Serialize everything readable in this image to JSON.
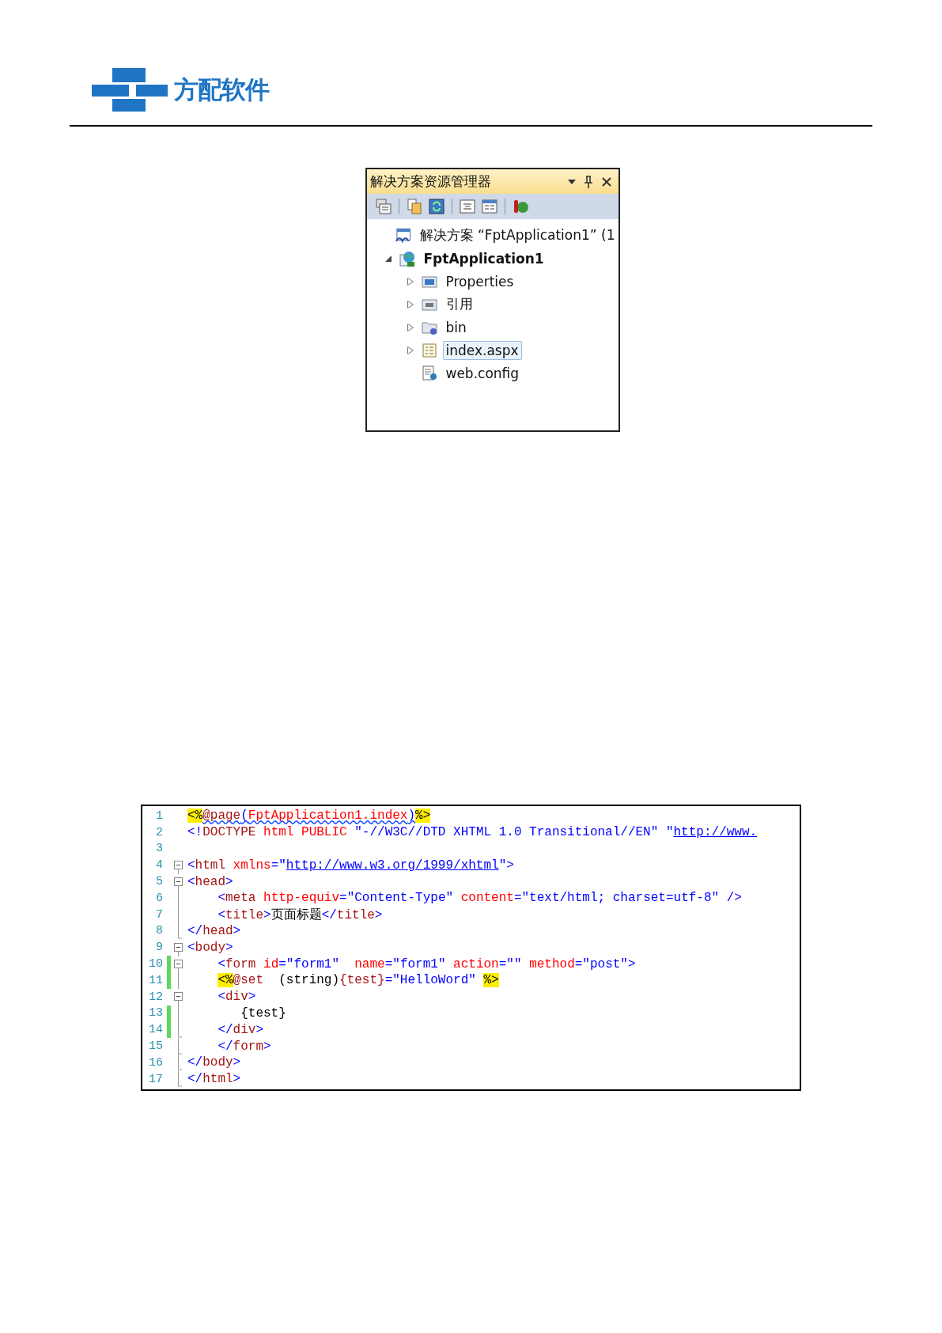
{
  "header": {
    "logo_text": "方配软件"
  },
  "solution_explorer": {
    "title": "解决方案资源管理器",
    "tree": [
      {
        "label": "解决方案 “FptApplication1” (1",
        "kind": "solution",
        "selected": false,
        "children": [
          {
            "label": "FptApplication1",
            "kind": "project",
            "expanded": true,
            "selected": false,
            "children": [
              {
                "label": "Properties",
                "kind": "properties",
                "expanded": false,
                "selected": false
              },
              {
                "label": "引用",
                "kind": "references",
                "expanded": false,
                "selected": false
              },
              {
                "label": "bin",
                "kind": "folder",
                "expanded": false,
                "selected": false
              },
              {
                "label": "index.aspx",
                "kind": "page",
                "expanded": false,
                "selected": true
              },
              {
                "label": "web.config",
                "kind": "config",
                "selected": false
              }
            ]
          }
        ]
      }
    ]
  },
  "code_editor": {
    "lines": [
      {
        "number": "1",
        "kind": "plain",
        "changed": false,
        "tokens": [
          {
            "kind": "directive",
            "text": "<%"
          },
          {
            "kind": "errtag",
            "text": "@page"
          },
          {
            "kind": "errdelim",
            "text": "("
          },
          {
            "kind": "errattr",
            "text": "FptApplication1.index"
          },
          {
            "kind": "errdelim",
            "text": ")"
          },
          {
            "kind": "directive",
            "text": "%>"
          }
        ]
      },
      {
        "number": "2",
        "kind": "plain",
        "changed": false,
        "tokens": [
          {
            "kind": "delim",
            "text": "<!"
          },
          {
            "kind": "tag",
            "text": "DOCTYPE"
          },
          {
            "kind": "attr",
            "text": " html PUBLIC "
          },
          {
            "kind": "value",
            "text": "\"-//W3C//DTD XHTML 1.0 Transitional//EN\" \""
          },
          {
            "kind": "link",
            "text": "http://www."
          }
        ]
      },
      {
        "number": "3",
        "kind": "plain",
        "changed": false
      },
      {
        "number": "4",
        "kind": "start",
        "changed": false,
        "tokens": [
          {
            "kind": "delim",
            "text": "<"
          },
          {
            "kind": "tag",
            "text": "html"
          },
          {
            "kind": "attr",
            "text": " xmlns"
          },
          {
            "kind": "delim",
            "text": "=\""
          },
          {
            "kind": "link",
            "text": "http://www.w3.org/1999/xhtml"
          },
          {
            "kind": "delim",
            "text": "\">"
          }
        ]
      },
      {
        "number": "5",
        "kind": "start",
        "changed": false,
        "tokens": [
          {
            "kind": "delim",
            "text": "<"
          },
          {
            "kind": "tag",
            "text": "head"
          },
          {
            "kind": "delim",
            "text": ">"
          }
        ]
      },
      {
        "number": "6",
        "kind": "inner",
        "changed": false,
        "tokens": [
          {
            "kind": "delim",
            "text": "    <"
          },
          {
            "kind": "tag",
            "text": "meta"
          },
          {
            "kind": "attr",
            "text": " http-equiv"
          },
          {
            "kind": "delim",
            "text": "="
          },
          {
            "kind": "value",
            "text": "\"Content-Type\""
          },
          {
            "kind": "attr",
            "text": " content"
          },
          {
            "kind": "delim",
            "text": "="
          },
          {
            "kind": "value",
            "text": "\"text/html; charset=utf-8\""
          },
          {
            "kind": "delim",
            "text": " />"
          }
        ]
      },
      {
        "number": "7",
        "kind": "inner",
        "changed": false,
        "tokens": [
          {
            "kind": "delim",
            "text": "    <"
          },
          {
            "kind": "tag",
            "text": "title"
          },
          {
            "kind": "delim",
            "text": ">"
          },
          {
            "kind": "text",
            "text": "页面标题"
          },
          {
            "kind": "delim",
            "text": "</"
          },
          {
            "kind": "tag",
            "text": "title"
          },
          {
            "kind": "delim",
            "text": ">"
          }
        ]
      },
      {
        "number": "8",
        "kind": "end",
        "changed": false,
        "tokens": [
          {
            "kind": "delim",
            "text": "</"
          },
          {
            "kind": "tag",
            "text": "head"
          },
          {
            "kind": "delim",
            "text": ">"
          }
        ]
      },
      {
        "number": "9",
        "kind": "start",
        "changed": false,
        "tokens": [
          {
            "kind": "delim",
            "text": "<"
          },
          {
            "kind": "tag",
            "text": "body"
          },
          {
            "kind": "delim",
            "text": ">"
          }
        ]
      },
      {
        "number": "10",
        "kind": "start",
        "changed": true,
        "tokens": [
          {
            "kind": "delim",
            "text": "    <"
          },
          {
            "kind": "tag",
            "text": "form"
          },
          {
            "kind": "attr",
            "text": " id"
          },
          {
            "kind": "delim",
            "text": "="
          },
          {
            "kind": "value",
            "text": "\"form1\""
          },
          {
            "kind": "attr",
            "text": "  name"
          },
          {
            "kind": "delim",
            "text": "="
          },
          {
            "kind": "value",
            "text": "\"form1\""
          },
          {
            "kind": "attr",
            "text": " action"
          },
          {
            "kind": "delim",
            "text": "="
          },
          {
            "kind": "value",
            "text": "\"\""
          },
          {
            "kind": "attr",
            "text": " method"
          },
          {
            "kind": "delim",
            "text": "="
          },
          {
            "kind": "value",
            "text": "\"post\""
          },
          {
            "kind": "delim",
            "text": ">"
          }
        ]
      },
      {
        "number": "11",
        "kind": "inner",
        "changed": true,
        "tokens": [
          {
            "kind": "indent"
          },
          {
            "kind": "directive",
            "text": "<%"
          },
          {
            "kind": "tag",
            "text": "@set"
          },
          {
            "kind": "text",
            "text": "  (string)"
          },
          {
            "kind": "tag",
            "text": "{test}"
          },
          {
            "kind": "value",
            "text": "=\"HelloWord\" "
          },
          {
            "kind": "directive",
            "text": "%>"
          }
        ]
      },
      {
        "number": "12",
        "kind": "start",
        "changed": false,
        "tokens": [
          {
            "kind": "delim",
            "text": "    <"
          },
          {
            "kind": "tag",
            "text": "div"
          },
          {
            "kind": "delim",
            "text": ">"
          }
        ]
      },
      {
        "number": "13",
        "kind": "inner",
        "changed": true,
        "tokens": [
          {
            "kind": "text",
            "text": "       {test}"
          }
        ]
      },
      {
        "number": "14",
        "kind": "end",
        "changed": true,
        "tokens": [
          {
            "kind": "delim",
            "text": "    </"
          },
          {
            "kind": "tag",
            "text": "div"
          },
          {
            "kind": "delim",
            "text": ">"
          }
        ]
      },
      {
        "number": "15",
        "kind": "end",
        "changed": false,
        "tokens": [
          {
            "kind": "delim",
            "text": "    </"
          },
          {
            "kind": "tag",
            "text": "form"
          },
          {
            "kind": "delim",
            "text": ">"
          }
        ]
      },
      {
        "number": "16",
        "kind": "end",
        "changed": false,
        "tokens": [
          {
            "kind": "delim",
            "text": "</"
          },
          {
            "kind": "tag",
            "text": "body"
          },
          {
            "kind": "delim",
            "text": ">"
          }
        ]
      },
      {
        "number": "17",
        "kind": "end",
        "changed": false,
        "tokens": [
          {
            "kind": "delim",
            "text": "</"
          },
          {
            "kind": "tag",
            "text": "html"
          },
          {
            "kind": "delim",
            "text": ">"
          }
        ]
      }
    ]
  }
}
